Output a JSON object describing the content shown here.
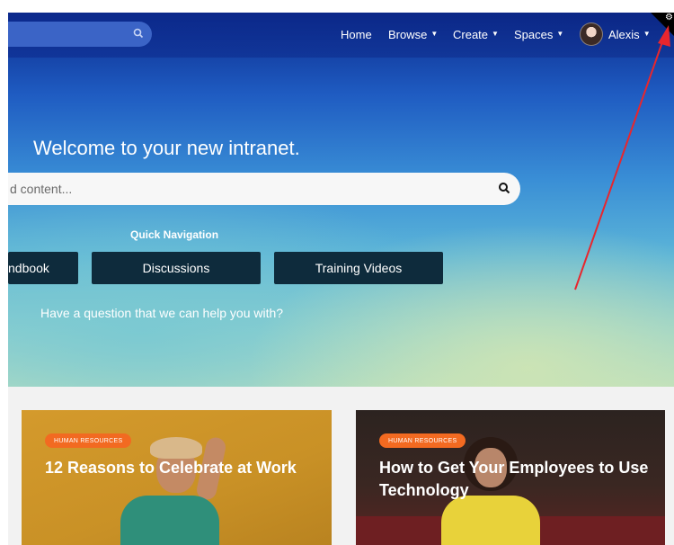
{
  "header": {
    "nav": {
      "home": "Home",
      "browse": "Browse",
      "create": "Create",
      "spaces": "Spaces",
      "user": "Alexis"
    }
  },
  "hero": {
    "welcome": "Welcome to your new intranet.",
    "search_placeholder": "d content...",
    "quick_nav_label": "Quick Navigation",
    "buttons": [
      "ndbook",
      "Discussions",
      "Training Videos"
    ],
    "question": "Have a question that we can help you with?"
  },
  "cards": [
    {
      "badge": "HUMAN RESOURCES",
      "title": "12 Reasons to Celebrate at Work"
    },
    {
      "badge": "HUMAN RESOURCES",
      "title": "How to Get Your Employees to Use Technology"
    }
  ],
  "colors": {
    "badge": "#f26a21",
    "quick_button": "#0e2b3c",
    "annotation_arrow": "#e8262d"
  },
  "icons": [
    "search-icon",
    "caret-down-icon",
    "avatar",
    "gear-icon"
  ]
}
